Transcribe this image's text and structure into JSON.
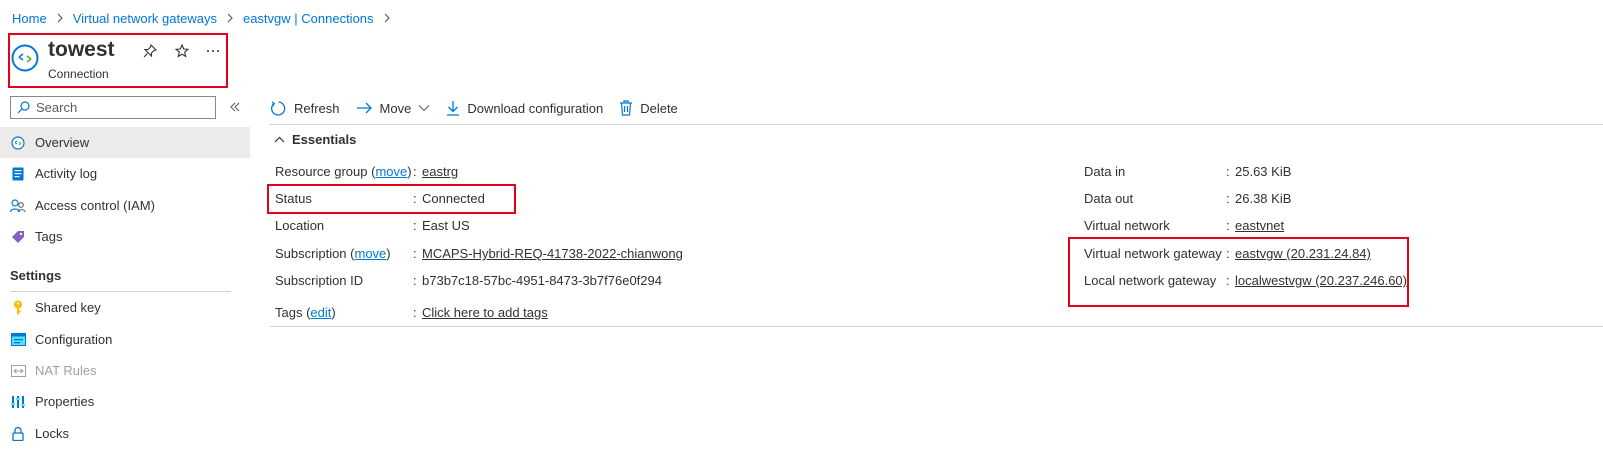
{
  "breadcrumb": {
    "items": [
      "Home",
      "Virtual network gateways",
      "eastvgw | Connections"
    ]
  },
  "header": {
    "title": "towest",
    "subtitle": "Connection"
  },
  "search": {
    "placeholder": "Search"
  },
  "sidebar": {
    "items": [
      {
        "label": "Overview",
        "icon": "connection-icon"
      },
      {
        "label": "Activity log",
        "icon": "activity-log-icon"
      },
      {
        "label": "Access control (IAM)",
        "icon": "iam-icon"
      },
      {
        "label": "Tags",
        "icon": "tag-icon"
      }
    ],
    "section_title": "Settings",
    "settings_items": [
      {
        "label": "Shared key",
        "icon": "key-icon"
      },
      {
        "label": "Configuration",
        "icon": "configuration-icon"
      },
      {
        "label": "NAT Rules",
        "icon": "nat-icon",
        "disabled": true
      },
      {
        "label": "Properties",
        "icon": "properties-icon"
      },
      {
        "label": "Locks",
        "icon": "lock-icon"
      }
    ]
  },
  "toolbar": {
    "refresh": "Refresh",
    "move": "Move",
    "download": "Download configuration",
    "delete": "Delete"
  },
  "essentials": {
    "title": "Essentials",
    "left": [
      {
        "label": "Resource group",
        "label_link": "move",
        "value": "eastrg",
        "value_is_link": true
      },
      {
        "label": "Status",
        "value": "Connected"
      },
      {
        "label": "Location",
        "value": "East US"
      },
      {
        "label": "Subscription",
        "label_link": "move",
        "value": "MCAPS-Hybrid-REQ-41738-2022-chianwong",
        "value_is_link": true
      },
      {
        "label": "Subscription ID",
        "value": "b73b7c18-57bc-4951-8473-3b7f76e0f294"
      },
      {
        "label": "Tags",
        "label_link": "edit",
        "value": "Click here to add tags",
        "value_is_link": true
      }
    ],
    "right": [
      {
        "label": "Data in",
        "value": "25.63 KiB"
      },
      {
        "label": "Data out",
        "value": "26.38 KiB"
      },
      {
        "label": "Virtual network",
        "value": "eastvnet",
        "value_is_link": true
      },
      {
        "label": "Virtual network gateway",
        "value": "eastvgw (20.231.24.84)",
        "value_is_link": true
      },
      {
        "label": "Local network gateway",
        "value": "localwestvgw (20.237.246.60)",
        "value_is_link": true
      }
    ]
  },
  "colors": {
    "accent": "#0078d4",
    "highlight_border": "#e3001b",
    "selected_nav": "#edebe9"
  }
}
